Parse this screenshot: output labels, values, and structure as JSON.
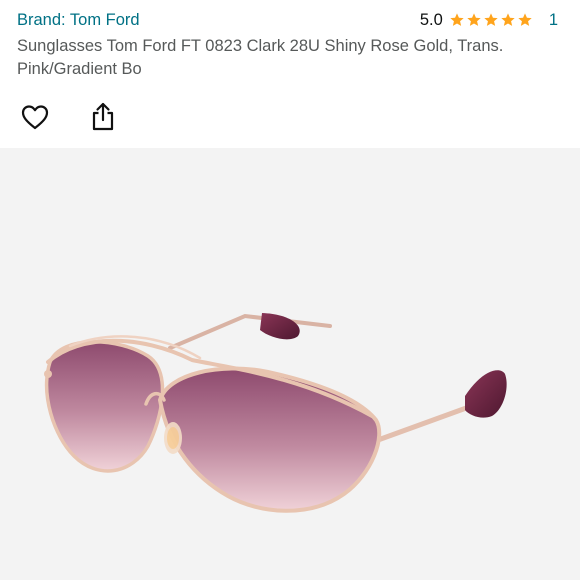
{
  "brand": {
    "label": "Brand: Tom Ford"
  },
  "rating": {
    "value": "5.0",
    "stars": 5,
    "count": "1",
    "star_color": "#ffa41c"
  },
  "product": {
    "title": "Sunglasses Tom Ford FT 0823 Clark 28U Shiny Rose Gold, Trans. Pink/Gradient Bo"
  },
  "actions": {
    "wishlist_icon": "heart-icon",
    "share_icon": "share-icon"
  },
  "colors": {
    "link": "#007185",
    "text_secondary": "#565959",
    "image_bg": "#f3f3f3",
    "lens_top": "#8e4a6e",
    "lens_bottom": "#f0c8d0",
    "frame": "#e8c4b0",
    "temple": "#6b2340"
  }
}
